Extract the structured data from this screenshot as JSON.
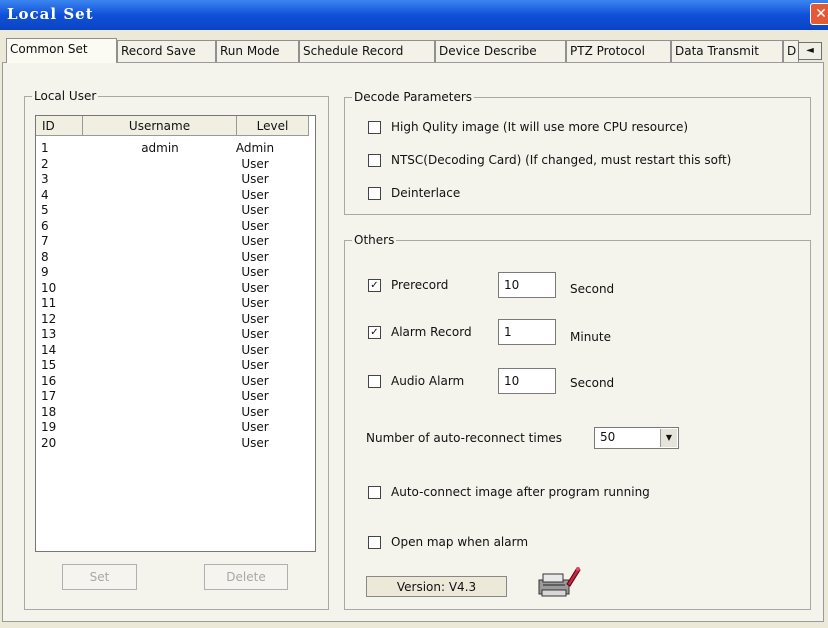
{
  "window": {
    "title": "Local Set",
    "close_glyph": "✕"
  },
  "tabs": [
    {
      "label": "Common Set"
    },
    {
      "label": "Record Save"
    },
    {
      "label": "Run Mode"
    },
    {
      "label": "Schedule Record"
    },
    {
      "label": "Device Describe"
    },
    {
      "label": "PTZ Protocol"
    },
    {
      "label": "Data Transmit"
    },
    {
      "label": "D"
    }
  ],
  "tab_scroll_glyph": "◄",
  "local_user": {
    "legend": "Local User",
    "columns": [
      "ID",
      "Username",
      "Level"
    ],
    "rows": [
      {
        "id": "1",
        "username": "admin",
        "level": "Admin"
      },
      {
        "id": "2",
        "username": "",
        "level": "User"
      },
      {
        "id": "3",
        "username": "",
        "level": "User"
      },
      {
        "id": "4",
        "username": "",
        "level": "User"
      },
      {
        "id": "5",
        "username": "",
        "level": "User"
      },
      {
        "id": "6",
        "username": "",
        "level": "User"
      },
      {
        "id": "7",
        "username": "",
        "level": "User"
      },
      {
        "id": "8",
        "username": "",
        "level": "User"
      },
      {
        "id": "9",
        "username": "",
        "level": "User"
      },
      {
        "id": "10",
        "username": "",
        "level": "User"
      },
      {
        "id": "11",
        "username": "",
        "level": "User"
      },
      {
        "id": "12",
        "username": "",
        "level": "User"
      },
      {
        "id": "13",
        "username": "",
        "level": "User"
      },
      {
        "id": "14",
        "username": "",
        "level": "User"
      },
      {
        "id": "15",
        "username": "",
        "level": "User"
      },
      {
        "id": "16",
        "username": "",
        "level": "User"
      },
      {
        "id": "17",
        "username": "",
        "level": "User"
      },
      {
        "id": "18",
        "username": "",
        "level": "User"
      },
      {
        "id": "19",
        "username": "",
        "level": "User"
      },
      {
        "id": "20",
        "username": "",
        "level": "User"
      }
    ],
    "set_button": "Set",
    "delete_button": "Delete"
  },
  "decode": {
    "legend": "Decode Parameters",
    "high_quality": {
      "label": "High Qulity image (It will use more CPU resource)",
      "checked": false
    },
    "ntsc": {
      "label": "NTSC(Decoding Card) (If changed, must restart this soft)",
      "checked": false
    },
    "deinterlace": {
      "label": "Deinterlace",
      "checked": false
    }
  },
  "others": {
    "legend": "Others",
    "prerecord": {
      "label": "Prerecord",
      "checked": true,
      "value": "10",
      "unit": "Second"
    },
    "alarm_record": {
      "label": "Alarm Record",
      "checked": true,
      "value": "1",
      "unit": "Minute"
    },
    "audio_alarm": {
      "label": "Audio Alarm",
      "checked": false,
      "value": "10",
      "unit": "Second"
    },
    "reconnect_label": "Number of auto-reconnect times",
    "reconnect_value": "50",
    "auto_connect": {
      "label": "Auto-connect image  after program running",
      "checked": false
    },
    "open_map": {
      "label": "Open map when alarm",
      "checked": false
    },
    "version": "Version: V4.3"
  }
}
